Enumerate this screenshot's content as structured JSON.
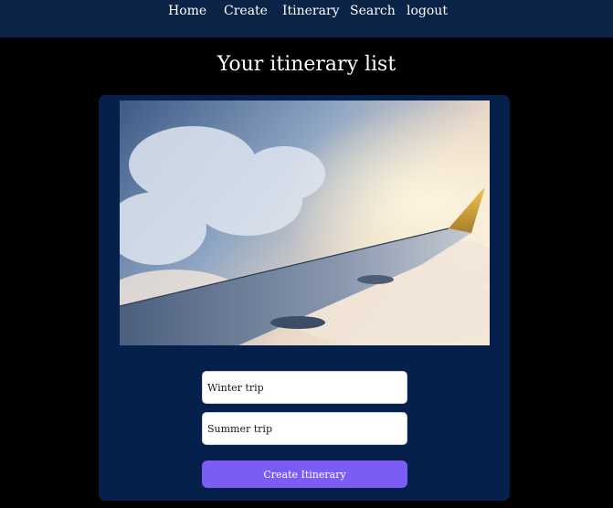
{
  "nav": {
    "items": [
      {
        "label": "Home"
      },
      {
        "label": "Create"
      },
      {
        "label": "Itinerary"
      },
      {
        "label": "Search"
      },
      {
        "label": "logout"
      }
    ]
  },
  "page": {
    "title": "Your itinerary list"
  },
  "card": {
    "image_description_icon": "airplane-wing-photo",
    "itineraries": [
      {
        "value": "Winter trip"
      },
      {
        "value": "Summer trip"
      }
    ],
    "create_button": "Create Itinerary"
  },
  "colors": {
    "navbar": "#0b2346",
    "background": "#000000",
    "card": "#05204a",
    "button": "#7b5cf5"
  }
}
